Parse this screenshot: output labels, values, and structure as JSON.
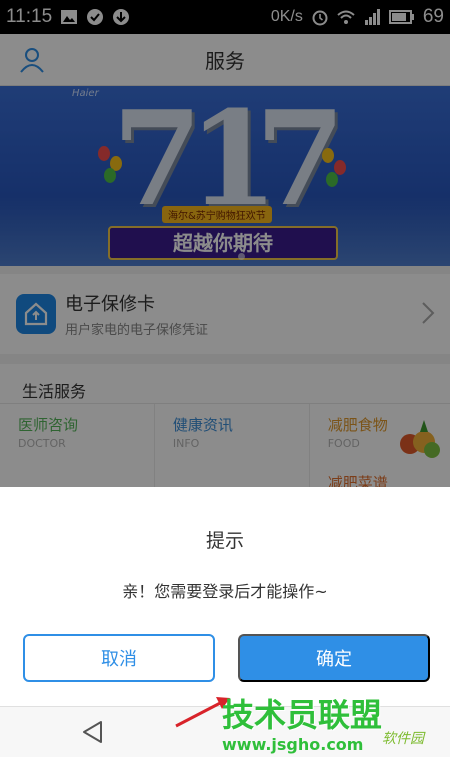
{
  "status_bar": {
    "time": "11:15",
    "network_speed": "0K/s",
    "battery": "69"
  },
  "header": {
    "title": "服务",
    "user_icon": "user-icon"
  },
  "banner": {
    "brand_logo": "Haier",
    "number_text": "717",
    "subtitle": "海尔&苏宁购物狂欢节",
    "slogan": "超越你期待"
  },
  "warranty_card": {
    "title": "电子保修卡",
    "subtitle": "用户家电的电子保修凭证",
    "icon": "home-icon"
  },
  "life_services": {
    "title": "生活服务",
    "items": [
      {
        "name": "医师咨询",
        "en": "DOCTOR",
        "color": "#56b65b"
      },
      {
        "name": "健康资讯",
        "en": "INFO",
        "color": "#3d8fd8"
      },
      {
        "name": "减肥食物",
        "en": "FOOD",
        "color": "#e09a2e"
      }
    ],
    "partial_item": "减肥菜谱"
  },
  "dialog": {
    "title": "提示",
    "message": "亲！您需要登录后才能操作~",
    "cancel_label": "取消",
    "confirm_label": "确定"
  },
  "watermark": {
    "text": "技术员联盟",
    "url": "www.jsgho.com",
    "sub": "软件园"
  },
  "colors": {
    "accent": "#2f8fe6"
  }
}
